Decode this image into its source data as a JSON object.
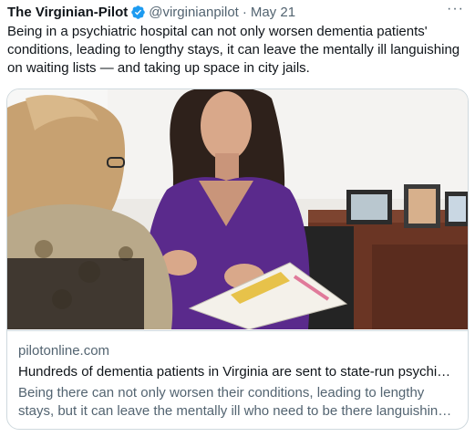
{
  "tweet": {
    "author": "The Virginian-Pilot",
    "handle": "@virginianpilot",
    "separator": "·",
    "date": "May 21",
    "more": "···",
    "text": "Being in a psychiatric hospital can not only worsen dementia patients' conditions, leading to lengthy stays, it can leave the mentally ill languishing on waiting lists — and taking up space in city jails."
  },
  "card": {
    "domain": "pilotonline.com",
    "title": "Hundreds of dementia patients in Virginia are sent to state-run psychi…",
    "description_line1": "Being there can not only worsen their conditions, leading to lengthy",
    "description_line2": "stays, but it can leave the mentally ill who need to be there languishin…"
  },
  "icons": {
    "verified": "verified-badge-icon",
    "more": "more-options-icon"
  },
  "colors": {
    "verified_blue": "#1d9bf0",
    "secondary_text": "#536471",
    "border": "#cfd9de",
    "shirt_purple": "#5a2a8c"
  }
}
